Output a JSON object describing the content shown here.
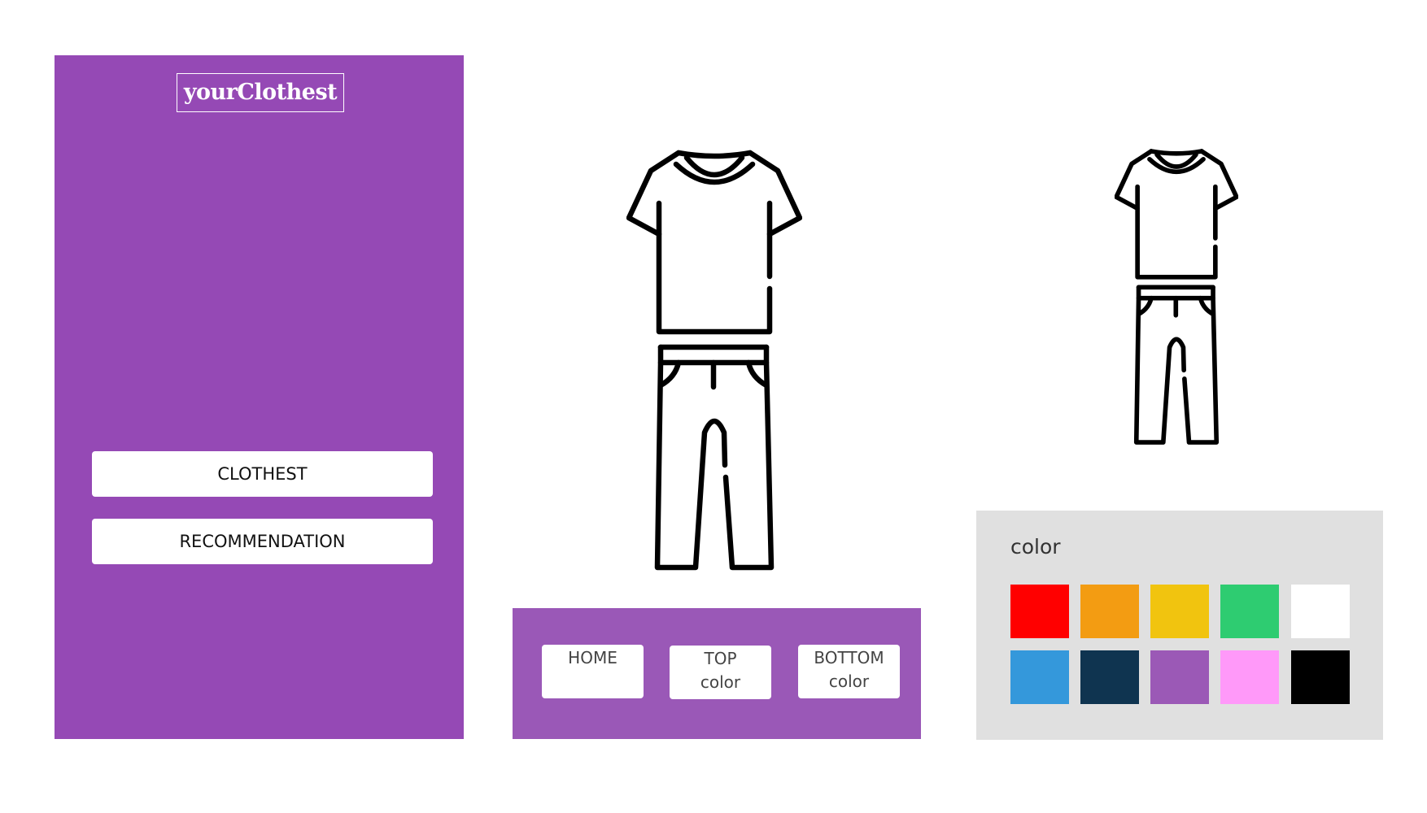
{
  "sidebar": {
    "logo_text": "yourClothest",
    "items": [
      {
        "label": "CLOTHEST"
      },
      {
        "label": "RECOMMENDATION"
      }
    ],
    "background": "#9549b5"
  },
  "nav": {
    "background": "#9a58b7",
    "home": {
      "label": "HOME"
    },
    "top": {
      "line1": "TOP",
      "line2": "color"
    },
    "bottom": {
      "line1": "BOTTOM",
      "line2": "color"
    }
  },
  "color_panel": {
    "title": "color",
    "swatches": [
      {
        "name": "red",
        "color": "#ff0000"
      },
      {
        "name": "orange",
        "color": "#f39c12"
      },
      {
        "name": "yellow",
        "color": "#f1c40f"
      },
      {
        "name": "green",
        "color": "#2ecc71"
      },
      {
        "name": "white",
        "color": "#ffffff"
      },
      {
        "name": "blue",
        "color": "#3498db"
      },
      {
        "name": "navy",
        "color": "#0f3450"
      },
      {
        "name": "purple",
        "color": "#9b59b6"
      },
      {
        "name": "pink",
        "color": "#ff99f9"
      },
      {
        "name": "black",
        "color": "#000000"
      }
    ]
  },
  "icons": {
    "shirt": "tshirt-icon",
    "pants": "pants-icon"
  }
}
